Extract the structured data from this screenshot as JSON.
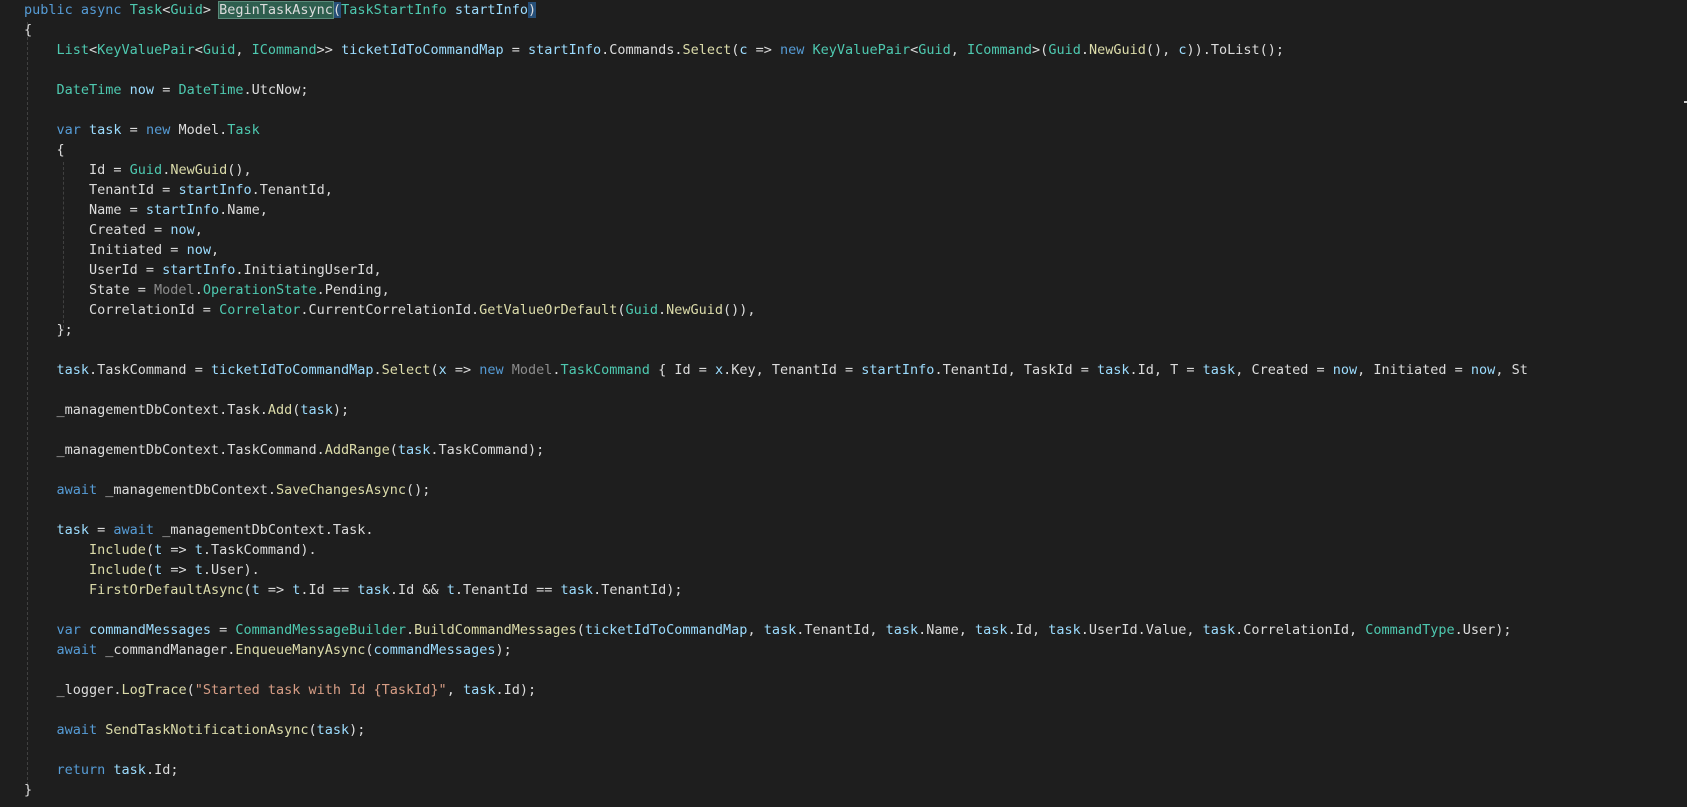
{
  "editor": {
    "theme": {
      "background": "#1e1e1e",
      "keyword": "#569cd6",
      "type": "#4ec9b0",
      "method": "#dcdcaa",
      "variable": "#9cdcfe",
      "string": "#d69d85",
      "plain": "#dcdcdc"
    },
    "lines": [
      [
        [
          "kw",
          "public "
        ],
        [
          "kw",
          "async "
        ],
        [
          "ty",
          "Task"
        ],
        [
          "pl",
          "<"
        ],
        [
          "ty",
          "Guid"
        ],
        [
          "pl",
          "> "
        ],
        [
          "hl2",
          "BeginTaskAsync"
        ],
        [
          "hl",
          "("
        ],
        [
          "ty",
          "TaskStartInfo "
        ],
        [
          "var",
          "startInfo"
        ],
        [
          "hl",
          ")"
        ]
      ],
      [
        [
          "pl",
          "{"
        ]
      ],
      [
        [
          "pl",
          "    "
        ],
        [
          "ty",
          "List"
        ],
        [
          "pl",
          "<"
        ],
        [
          "ty",
          "KeyValuePair"
        ],
        [
          "pl",
          "<"
        ],
        [
          "ty",
          "Guid"
        ],
        [
          "pl",
          ", "
        ],
        [
          "ty",
          "ICommand"
        ],
        [
          "pl",
          ">> "
        ],
        [
          "var",
          "ticketIdToCommandMap"
        ],
        [
          "pl",
          " = "
        ],
        [
          "var",
          "startInfo"
        ],
        [
          "pl",
          ".Commands."
        ],
        [
          "me",
          "Select"
        ],
        [
          "pl",
          "("
        ],
        [
          "var",
          "c"
        ],
        [
          "pl",
          " => "
        ],
        [
          "kw",
          "new "
        ],
        [
          "ty",
          "KeyValuePair"
        ],
        [
          "pl",
          "<"
        ],
        [
          "ty",
          "Guid"
        ],
        [
          "pl",
          ", "
        ],
        [
          "ty",
          "ICommand"
        ],
        [
          "pl",
          ">("
        ],
        [
          "ty",
          "Guid"
        ],
        [
          "pl",
          "."
        ],
        [
          "me",
          "NewGuid"
        ],
        [
          "pl",
          "(), "
        ],
        [
          "var",
          "c"
        ],
        [
          "pl",
          ")).ToList();"
        ]
      ],
      [],
      [
        [
          "pl",
          "    "
        ],
        [
          "ty",
          "DateTime "
        ],
        [
          "var",
          "now"
        ],
        [
          "pl",
          " = "
        ],
        [
          "ty",
          "DateTime"
        ],
        [
          "pl",
          ".UtcNow;"
        ]
      ],
      [],
      [
        [
          "pl",
          "    "
        ],
        [
          "kw",
          "var "
        ],
        [
          "var",
          "task"
        ],
        [
          "pl",
          " = "
        ],
        [
          "kw",
          "new "
        ],
        [
          "pl",
          "Model."
        ],
        [
          "ty",
          "Task"
        ]
      ],
      [
        [
          "pl",
          "    {"
        ]
      ],
      [
        [
          "pl",
          "        Id = "
        ],
        [
          "ty",
          "Guid"
        ],
        [
          "pl",
          "."
        ],
        [
          "me",
          "NewGuid"
        ],
        [
          "pl",
          "(),"
        ]
      ],
      [
        [
          "pl",
          "        TenantId = "
        ],
        [
          "var",
          "startInfo"
        ],
        [
          "pl",
          ".TenantId,"
        ]
      ],
      [
        [
          "pl",
          "        Name = "
        ],
        [
          "var",
          "startInfo"
        ],
        [
          "pl",
          ".Name,"
        ]
      ],
      [
        [
          "pl",
          "        Created = "
        ],
        [
          "var",
          "now"
        ],
        [
          "pl",
          ","
        ]
      ],
      [
        [
          "pl",
          "        Initiated = "
        ],
        [
          "var",
          "now"
        ],
        [
          "pl",
          ","
        ]
      ],
      [
        [
          "pl",
          "        UserId = "
        ],
        [
          "var",
          "startInfo"
        ],
        [
          "pl",
          ".InitiatingUserId,"
        ]
      ],
      [
        [
          "pl",
          "        State = "
        ],
        [
          "ns",
          "Model"
        ],
        [
          "pl",
          "."
        ],
        [
          "ty",
          "OperationState"
        ],
        [
          "pl",
          ".Pending,"
        ]
      ],
      [
        [
          "pl",
          "        CorrelationId = "
        ],
        [
          "ty",
          "Correlator"
        ],
        [
          "pl",
          ".CurrentCorrelationId."
        ],
        [
          "me",
          "GetValueOrDefault"
        ],
        [
          "pl",
          "("
        ],
        [
          "ty",
          "Guid"
        ],
        [
          "pl",
          "."
        ],
        [
          "me",
          "NewGuid"
        ],
        [
          "pl",
          "()),"
        ]
      ],
      [
        [
          "pl",
          "    };"
        ]
      ],
      [],
      [
        [
          "pl",
          "    "
        ],
        [
          "var",
          "task"
        ],
        [
          "pl",
          ".TaskCommand = "
        ],
        [
          "var",
          "ticketIdToCommandMap"
        ],
        [
          "pl",
          "."
        ],
        [
          "me",
          "Select"
        ],
        [
          "pl",
          "("
        ],
        [
          "var",
          "x"
        ],
        [
          "pl",
          " => "
        ],
        [
          "kw",
          "new "
        ],
        [
          "ns",
          "Model"
        ],
        [
          "pl",
          "."
        ],
        [
          "ty",
          "TaskCommand"
        ],
        [
          "pl",
          " { Id = "
        ],
        [
          "var",
          "x"
        ],
        [
          "pl",
          ".Key, TenantId = "
        ],
        [
          "var",
          "startInfo"
        ],
        [
          "pl",
          ".TenantId, TaskId = "
        ],
        [
          "var",
          "task"
        ],
        [
          "pl",
          ".Id, T = "
        ],
        [
          "var",
          "task"
        ],
        [
          "pl",
          ", Created = "
        ],
        [
          "var",
          "now"
        ],
        [
          "pl",
          ", Initiated = "
        ],
        [
          "var",
          "now"
        ],
        [
          "pl",
          ", St"
        ]
      ],
      [],
      [
        [
          "pl",
          "    _managementDbContext.Task."
        ],
        [
          "me",
          "Add"
        ],
        [
          "pl",
          "("
        ],
        [
          "var",
          "task"
        ],
        [
          "pl",
          ");"
        ]
      ],
      [],
      [
        [
          "pl",
          "    _managementDbContext.TaskCommand."
        ],
        [
          "me",
          "AddRange"
        ],
        [
          "pl",
          "("
        ],
        [
          "var",
          "task"
        ],
        [
          "pl",
          ".TaskCommand);"
        ]
      ],
      [],
      [
        [
          "pl",
          "    "
        ],
        [
          "kw",
          "await "
        ],
        [
          "pl",
          "_managementDbContext."
        ],
        [
          "me",
          "SaveChangesAsync"
        ],
        [
          "pl",
          "();"
        ]
      ],
      [],
      [
        [
          "pl",
          "    "
        ],
        [
          "var",
          "task"
        ],
        [
          "pl",
          " = "
        ],
        [
          "kw",
          "await "
        ],
        [
          "pl",
          "_managementDbContext.Task."
        ]
      ],
      [
        [
          "pl",
          "        "
        ],
        [
          "me",
          "Include"
        ],
        [
          "pl",
          "("
        ],
        [
          "var",
          "t"
        ],
        [
          "pl",
          " => "
        ],
        [
          "var",
          "t"
        ],
        [
          "pl",
          ".TaskCommand)."
        ]
      ],
      [
        [
          "pl",
          "        "
        ],
        [
          "me",
          "Include"
        ],
        [
          "pl",
          "("
        ],
        [
          "var",
          "t"
        ],
        [
          "pl",
          " => "
        ],
        [
          "var",
          "t"
        ],
        [
          "pl",
          ".User)."
        ]
      ],
      [
        [
          "pl",
          "        "
        ],
        [
          "me",
          "FirstOrDefaultAsync"
        ],
        [
          "pl",
          "("
        ],
        [
          "var",
          "t"
        ],
        [
          "pl",
          " => "
        ],
        [
          "var",
          "t"
        ],
        [
          "pl",
          ".Id == "
        ],
        [
          "var",
          "task"
        ],
        [
          "pl",
          ".Id && "
        ],
        [
          "var",
          "t"
        ],
        [
          "pl",
          ".TenantId == "
        ],
        [
          "var",
          "task"
        ],
        [
          "pl",
          ".TenantId);"
        ]
      ],
      [],
      [
        [
          "pl",
          "    "
        ],
        [
          "kw",
          "var "
        ],
        [
          "var",
          "commandMessages"
        ],
        [
          "pl",
          " = "
        ],
        [
          "ty",
          "CommandMessageBuilder"
        ],
        [
          "pl",
          "."
        ],
        [
          "me",
          "BuildCommandMessages"
        ],
        [
          "pl",
          "("
        ],
        [
          "var",
          "ticketIdToCommandMap"
        ],
        [
          "pl",
          ", "
        ],
        [
          "var",
          "task"
        ],
        [
          "pl",
          ".TenantId, "
        ],
        [
          "var",
          "task"
        ],
        [
          "pl",
          ".Name, "
        ],
        [
          "var",
          "task"
        ],
        [
          "pl",
          ".Id, "
        ],
        [
          "var",
          "task"
        ],
        [
          "pl",
          ".UserId.Value, "
        ],
        [
          "var",
          "task"
        ],
        [
          "pl",
          ".CorrelationId, "
        ],
        [
          "ty",
          "CommandType"
        ],
        [
          "pl",
          ".User);"
        ]
      ],
      [
        [
          "pl",
          "    "
        ],
        [
          "kw",
          "await "
        ],
        [
          "pl",
          "_commandManager."
        ],
        [
          "me",
          "EnqueueManyAsync"
        ],
        [
          "pl",
          "("
        ],
        [
          "var",
          "commandMessages"
        ],
        [
          "pl",
          ");"
        ]
      ],
      [],
      [
        [
          "pl",
          "    _logger."
        ],
        [
          "me",
          "LogTrace"
        ],
        [
          "pl",
          "("
        ],
        [
          "str",
          "\"Started task with Id {TaskId}\""
        ],
        [
          "pl",
          ", "
        ],
        [
          "var",
          "task"
        ],
        [
          "pl",
          ".Id);"
        ]
      ],
      [],
      [
        [
          "pl",
          "    "
        ],
        [
          "kw",
          "await "
        ],
        [
          "me",
          "SendTaskNotificationAsync"
        ],
        [
          "pl",
          "("
        ],
        [
          "var",
          "task"
        ],
        [
          "pl",
          ");"
        ]
      ],
      [],
      [
        [
          "pl",
          "    "
        ],
        [
          "kw",
          "return "
        ],
        [
          "var",
          "task"
        ],
        [
          "pl",
          ".Id;"
        ]
      ],
      [
        [
          "pl",
          "}"
        ]
      ]
    ]
  }
}
